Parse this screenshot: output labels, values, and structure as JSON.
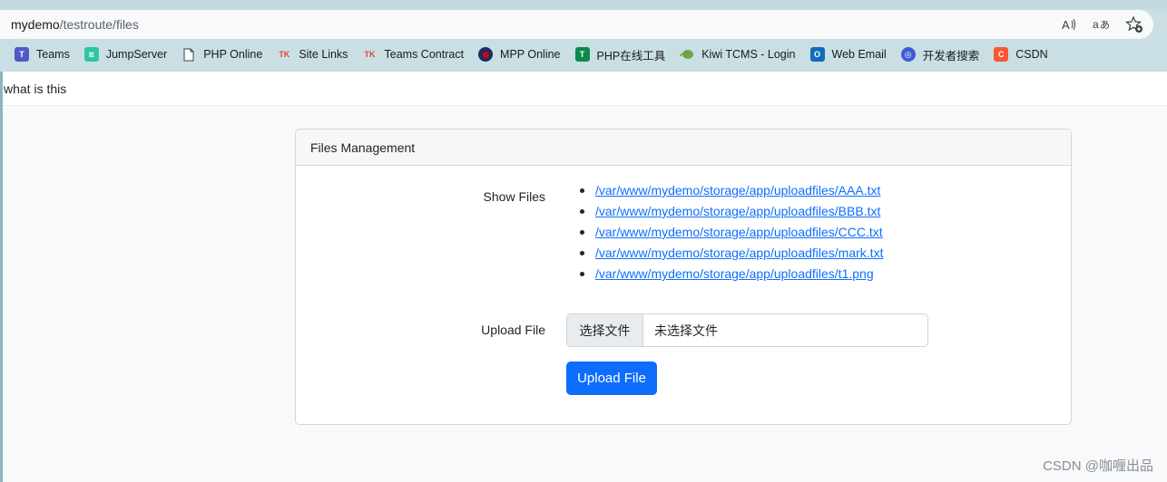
{
  "browser": {
    "url_host": "mydemo",
    "url_path": "/testroute/files",
    "icons": [
      "read-aloud-icon",
      "translate-icon",
      "favorite-add-icon"
    ],
    "bookmarks": [
      {
        "label": "Teams",
        "icon": "teams-icon",
        "color": "#5059c9"
      },
      {
        "label": "JumpServer",
        "icon": "jumpserver-icon",
        "color": "#2ec4a6"
      },
      {
        "label": "PHP Online",
        "icon": "document-icon",
        "color": "#ffffff"
      },
      {
        "label": "Site Links",
        "icon": "tk-icon",
        "color": "#e8453c"
      },
      {
        "label": "Teams Contract",
        "icon": "tk-icon",
        "color": "#e8453c"
      },
      {
        "label": "MPP Online",
        "icon": "mpp-icon",
        "color": "#d0021b"
      },
      {
        "label": "PHP在线工具",
        "icon": "php-tool-icon",
        "color": "#0a8a4a"
      },
      {
        "label": "Kiwi TCMS - Login",
        "icon": "kiwi-icon",
        "color": "#6da544"
      },
      {
        "label": "Web Email",
        "icon": "outlook-icon",
        "color": "#0f6cbd"
      },
      {
        "label": "开发者搜索",
        "icon": "dev-search-icon",
        "color": "#3b5bdb"
      },
      {
        "label": "CSDN",
        "icon": "csdn-icon",
        "color": "#fc5531"
      }
    ]
  },
  "page": {
    "topbar_text": "what is this"
  },
  "card": {
    "title": "Files Management",
    "show_files_label": "Show Files",
    "files": [
      "/var/www/mydemo/storage/app/uploadfiles/AAA.txt",
      "/var/www/mydemo/storage/app/uploadfiles/BBB.txt",
      "/var/www/mydemo/storage/app/uploadfiles/CCC.txt",
      "/var/www/mydemo/storage/app/uploadfiles/mark.txt",
      "/var/www/mydemo/storage/app/uploadfiles/t1.png"
    ],
    "upload_label": "Upload File",
    "file_button": "选择文件",
    "file_status": "未选择文件",
    "submit_label": "Upload File",
    "accent": "#0d6efd"
  },
  "watermark": "CSDN @咖喱出品"
}
